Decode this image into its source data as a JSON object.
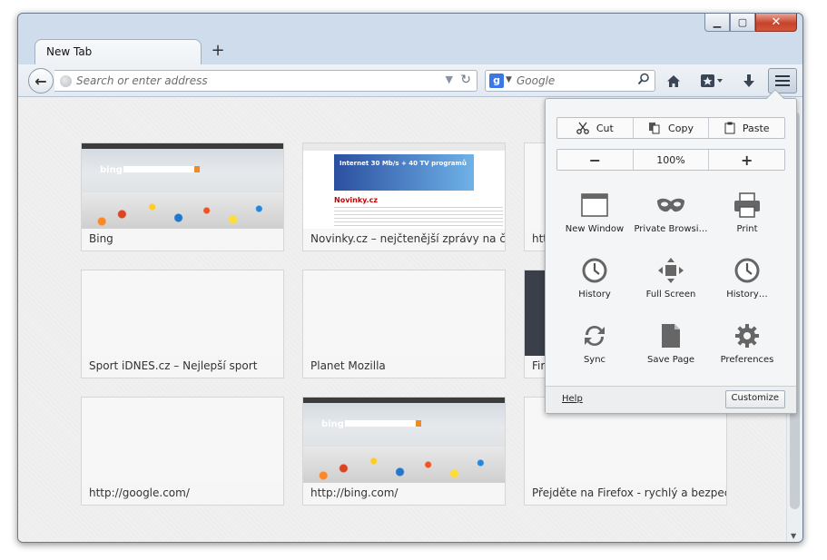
{
  "tab": {
    "label": "New Tab"
  },
  "urlbar": {
    "placeholder": "Search or enter address"
  },
  "searchbar": {
    "engine_letter": "g",
    "placeholder": "Google"
  },
  "tiles": [
    {
      "title": "Bing",
      "kind": "bing"
    },
    {
      "title": "Novinky.cz – nejčtenější zprávy na če…",
      "kind": "novinky",
      "ad_text": "Internet 30 Mb/s + 40 TV programů",
      "logo": "Novinky.cz"
    },
    {
      "title": "htt",
      "kind": "blank"
    },
    {
      "title": "Sport iDNES.cz – Nejlepší sport",
      "kind": "blank"
    },
    {
      "title": "Planet Mozilla",
      "kind": "blank"
    },
    {
      "title": "Fire",
      "kind": "dark"
    },
    {
      "title": "http://google.com/",
      "kind": "blank"
    },
    {
      "title": "http://bing.com/",
      "kind": "bing"
    },
    {
      "title": "Přejděte na Firefox - rychlý a bezpečn…",
      "kind": "blank"
    }
  ],
  "menu": {
    "edit": {
      "cut": "Cut",
      "copy": "Copy",
      "paste": "Paste"
    },
    "zoom": {
      "out": "−",
      "level": "100%",
      "in": "+"
    },
    "items": [
      {
        "label": "New Window",
        "icon": "new-window-icon"
      },
      {
        "label": "Private Browsi…",
        "icon": "private-mask-icon"
      },
      {
        "label": "Print",
        "icon": "printer-icon"
      },
      {
        "label": "History",
        "icon": "clock-icon"
      },
      {
        "label": "Full Screen",
        "icon": "fullscreen-icon"
      },
      {
        "label": "History…",
        "icon": "clock-icon"
      },
      {
        "label": "Sync",
        "icon": "sync-icon"
      },
      {
        "label": "Save Page",
        "icon": "page-icon"
      },
      {
        "label": "Preferences",
        "icon": "gear-icon"
      }
    ],
    "help": "Help",
    "customize": "Customize"
  },
  "colors": {
    "accent": "#3b78e7",
    "close_button": "#c7432a",
    "titlebar": "#cfdceb"
  }
}
